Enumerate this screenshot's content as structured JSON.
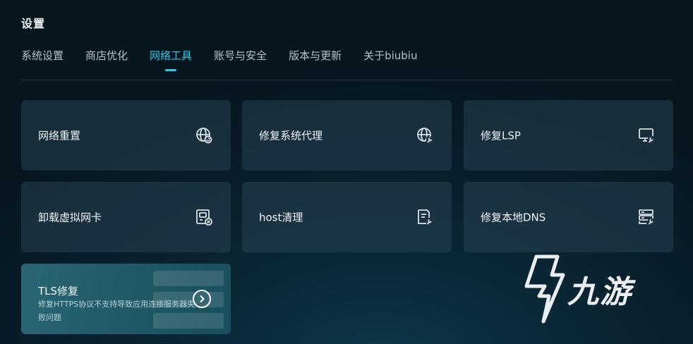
{
  "page": {
    "title": "设置"
  },
  "tabs": [
    {
      "label": "系统设置",
      "active": false
    },
    {
      "label": "商店优化",
      "active": false
    },
    {
      "label": "网络工具",
      "active": true
    },
    {
      "label": "账号与安全",
      "active": false
    },
    {
      "label": "版本与更新",
      "active": false
    },
    {
      "label": "关于biubiu",
      "active": false
    }
  ],
  "tools": [
    {
      "label": "网络重置",
      "icon": "globe-refresh-icon"
    },
    {
      "label": "修复系统代理",
      "icon": "globe-wrench-icon"
    },
    {
      "label": "修复LSP",
      "icon": "monitor-wrench-icon"
    },
    {
      "label": "卸载虚拟网卡",
      "icon": "network-card-remove-icon"
    },
    {
      "label": "host清理",
      "icon": "document-wrench-icon"
    },
    {
      "label": "修复本地DNS",
      "icon": "server-wrench-icon"
    }
  ],
  "featured_tool": {
    "label": "TLS修复",
    "description": "修复HTTPS协议不支持导致应用连接服务器失败问题",
    "icon": "arrow-right-circle-icon"
  },
  "watermark": {
    "text": "九游"
  },
  "colors": {
    "accent": "#2ec9e6",
    "card_bg": "#264252",
    "featured_bg": "#2a6674"
  }
}
